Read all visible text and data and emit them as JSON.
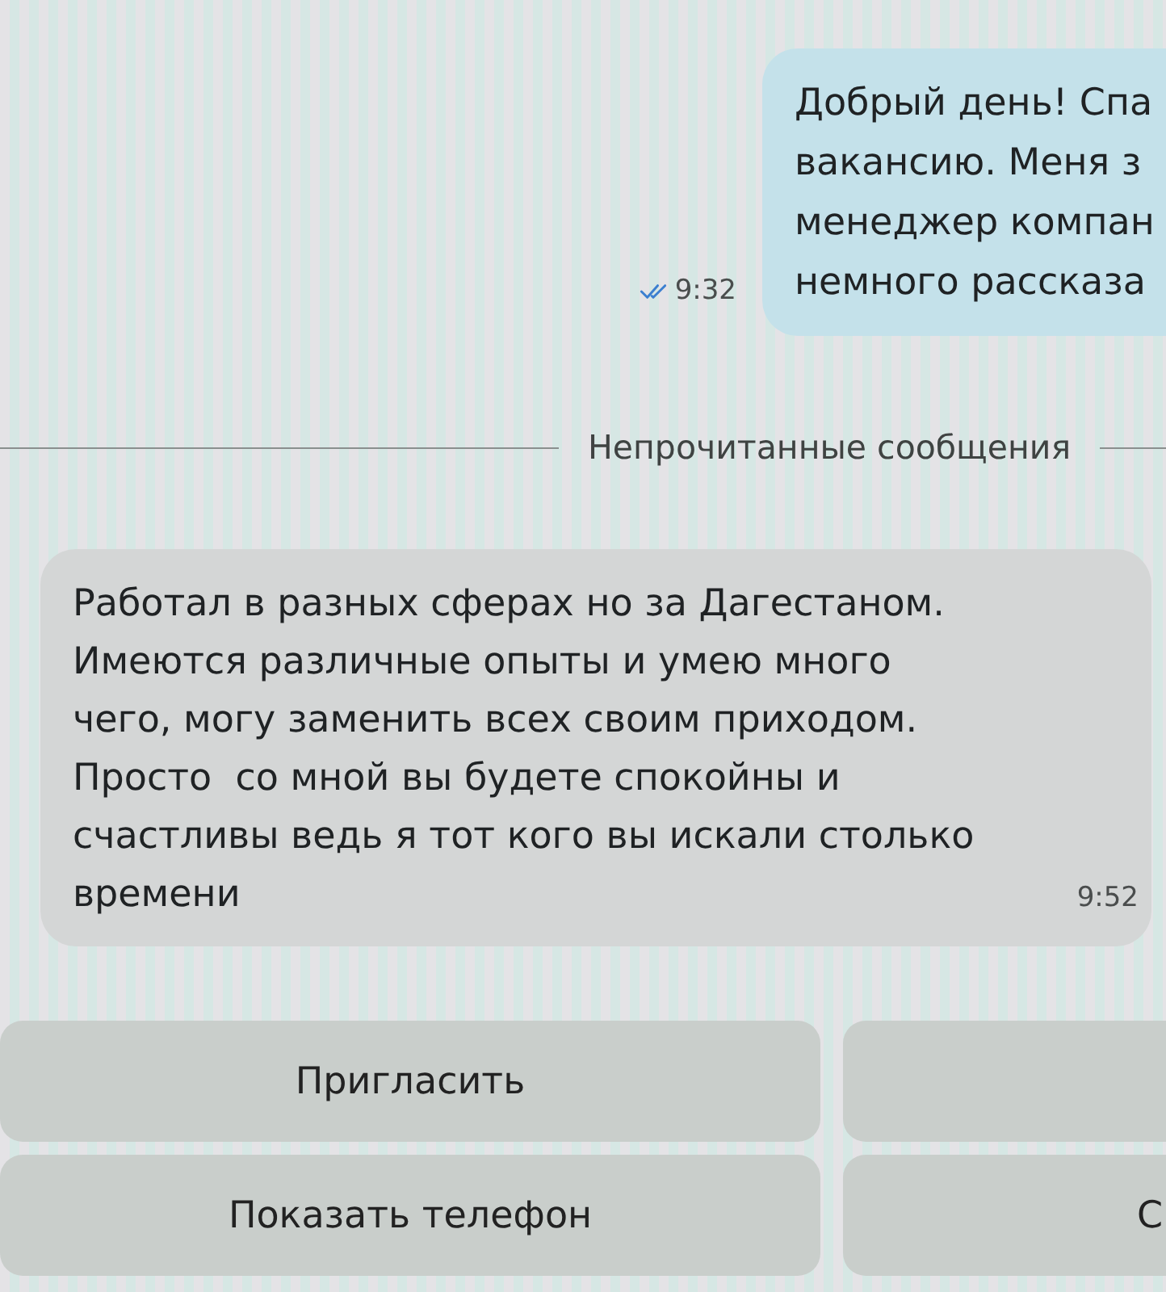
{
  "outgoing_message": {
    "lines": [
      "Добрый день! Спа",
      "вакансию. Меня з",
      "менеджер компан",
      "немного рассказа"
    ],
    "time": "9:32",
    "read": true
  },
  "divider": {
    "label": "Непрочитанные сообщения"
  },
  "incoming_message": {
    "lines": [
      "Работал в разных сферах но за Дагестаном.",
      "Имеются различные опыты и умею много",
      "чего, могу заменить всех своим приходом.",
      "Просто  со мной вы будете спокойны и",
      "счастливы ведь я тот кого вы искали столько",
      "времени"
    ],
    "time": "9:52"
  },
  "actions": [
    {
      "kind": "full",
      "label": "Пригласить"
    },
    {
      "kind": "clipped"
    },
    {
      "kind": "full",
      "label": "Показать телефон"
    },
    {
      "kind": "clipped",
      "label": "С"
    }
  ]
}
